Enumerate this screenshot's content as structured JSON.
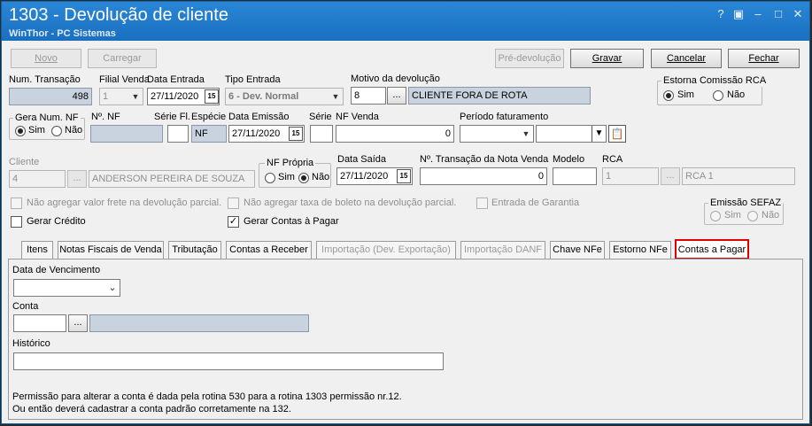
{
  "window": {
    "title": "1303 - Devolução de cliente",
    "subtitle": "WinThor - PC Sistemas",
    "controls": [
      "?",
      "▣",
      "–",
      "□",
      "✕"
    ]
  },
  "toolbar": {
    "novo": "Novo",
    "carregar": "Carregar",
    "pre_devolucao": "Pré-devolução",
    "gravar": "Gravar",
    "cancelar": "Cancelar",
    "fechar": "Fechar"
  },
  "row1": {
    "num_transacao_label": "Num. Transação",
    "num_transacao_value": "498",
    "filial_venda_label": "Filial Venda",
    "filial_venda_value": "1",
    "data_entrada_label": "Data Entrada",
    "data_entrada_value": "27/11/2020",
    "tipo_entrada_label": "Tipo Entrada",
    "tipo_entrada_value": "6 - Dev. Normal",
    "motivo_label": "Motivo da devolução",
    "motivo_code": "8",
    "motivo_desc": "CLIENTE FORA DE ROTA",
    "estorna_label": "Estorna Comissão RCA",
    "estorna_sim": "Sim",
    "estorna_nao": "Não"
  },
  "row2": {
    "gera_num_label": "Gera Num. NF",
    "gera_sim": "Sim",
    "gera_nao": "Não",
    "num_nf_label": "Nº. NF",
    "serie_fl_label": "Série Fl.",
    "especie_label": "Espécie",
    "especie_value": "NF",
    "data_emissao_label": "Data Emissão",
    "data_emissao_value": "27/11/2020",
    "serie_label": "Série",
    "nf_venda_label": "NF Venda",
    "nf_venda_value": "0",
    "periodo_label": "Período faturamento"
  },
  "row3": {
    "cliente_label": "Cliente",
    "cliente_code": "4",
    "cliente_name": "ANDERSON PEREIRA DE SOUZA",
    "nf_propria_label": "NF Própria",
    "nf_sim": "Sim",
    "nf_nao": "Não",
    "data_saida_label": "Data Saída",
    "data_saida_value": "27/11/2020",
    "num_transacao_nota_label": "Nº. Transação da Nota Venda",
    "num_transacao_nota_value": "0",
    "modelo_label": "Modelo",
    "rca_label": "RCA",
    "rca_code": "1",
    "rca_name": "RCA 1"
  },
  "options": {
    "nao_agregar_frete": "Não agregar valor frete na devolução parcial.",
    "nao_agregar_taxa": "Não agregar taxa de boleto na devolução parcial.",
    "entrada_garantia": "Entrada de Garantia",
    "gerar_credito": "Gerar Crédito",
    "gerar_contas": "Gerar Contas à Pagar",
    "emissao_sefaz_label": "Emissão SEFAZ",
    "sefaz_sim": "Sim",
    "sefaz_nao": "Não"
  },
  "tabs": [
    {
      "label": "Itens"
    },
    {
      "label": "Notas Fiscais de Venda"
    },
    {
      "label": "Tributação"
    },
    {
      "label": "Contas a Receber"
    },
    {
      "label": "Importação (Dev. Exportação)"
    },
    {
      "label": "Importação DANF"
    },
    {
      "label": "Chave NFe"
    },
    {
      "label": "Estorno NFe"
    },
    {
      "label": "Contas a Pagar"
    }
  ],
  "panel": {
    "data_vencimento_label": "Data de Vencimento",
    "conta_label": "Conta",
    "historico_label": "Histórico",
    "info_line1": "Permissão para alterar a conta é dada pela rotina 530 para a rotina 1303 permissão nr.12.",
    "info_line2": "Ou então deverá cadastrar a conta padrão corretamente na 132."
  }
}
